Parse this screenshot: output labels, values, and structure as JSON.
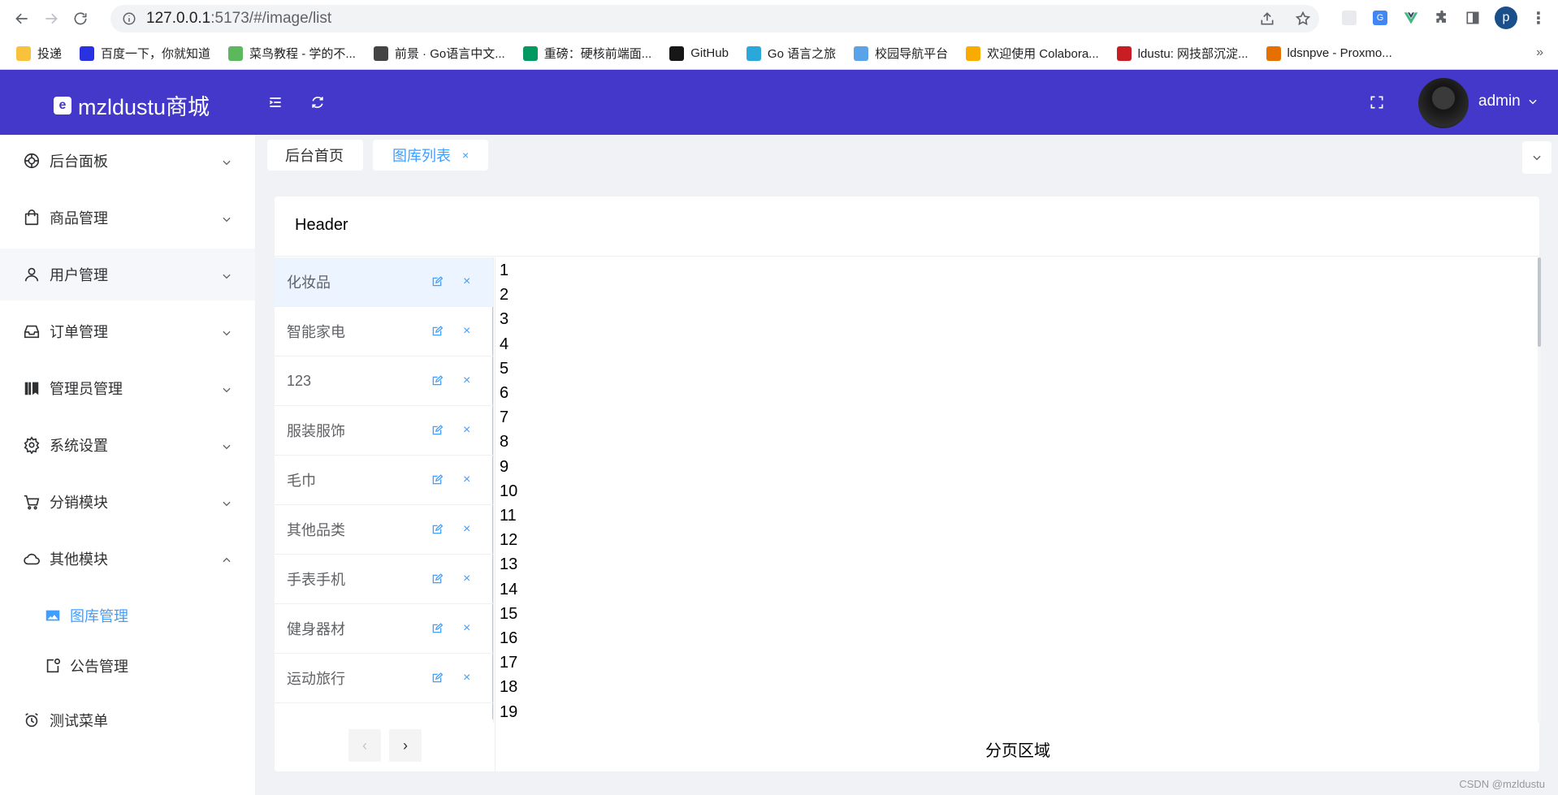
{
  "browser": {
    "url_host": "127.0.0.1",
    "url_rest": ":5173/#/image/list",
    "profile_initial": "p",
    "bookmarks": [
      {
        "label": "投递",
        "color": "#f9c23c"
      },
      {
        "label": "百度一下，你就知道",
        "color": "#2932e1"
      },
      {
        "label": "菜鸟教程 - 学的不...",
        "color": "#5cb85c"
      },
      {
        "label": "前景 · Go语言中文...",
        "color": "#444444"
      },
      {
        "label": "重磅：硬核前端面...",
        "color": "#009a61"
      },
      {
        "label": "GitHub",
        "color": "#181717"
      },
      {
        "label": "Go 语言之旅",
        "color": "#2aa8d9"
      },
      {
        "label": "校园导航平台",
        "color": "#5aa3e8"
      },
      {
        "label": "欢迎使用 Colabora...",
        "color": "#f9ab00"
      },
      {
        "label": "ldustu: 网技部沉淀...",
        "color": "#c71d23"
      },
      {
        "label": "ldsnpve - Proxmo...",
        "color": "#e57000"
      }
    ],
    "more": "»"
  },
  "header": {
    "logo_text": "mzldustu商城",
    "user_name": "admin"
  },
  "sidebar": {
    "items": [
      {
        "label": "后台面板",
        "icon": "dashboard-icon"
      },
      {
        "label": "商品管理",
        "icon": "shopping-bag-icon"
      },
      {
        "label": "用户管理",
        "icon": "user-icon"
      },
      {
        "label": "订单管理",
        "icon": "inbox-icon"
      },
      {
        "label": "管理员管理",
        "icon": "collection-icon"
      },
      {
        "label": "系统设置",
        "icon": "gear-icon"
      },
      {
        "label": "分销模块",
        "icon": "cart-icon"
      },
      {
        "label": "其他模块",
        "icon": "cloud-icon"
      }
    ],
    "sub_items": [
      {
        "label": "图库管理",
        "icon": "picture-icon",
        "active": true
      },
      {
        "label": "公告管理",
        "icon": "notification-icon",
        "active": false
      }
    ],
    "last_item": {
      "label": "测试菜单",
      "icon": "alarm-clock-icon"
    }
  },
  "tabs": [
    {
      "label": "后台首页",
      "active": false
    },
    {
      "label": "图库列表",
      "active": true,
      "close": "×"
    }
  ],
  "card": {
    "header_title": "Header",
    "categories": [
      "化妆品",
      "智能家电",
      "123",
      "服装服饰",
      "毛巾",
      "其他品类",
      "手表手机",
      "健身器材",
      "运动旅行"
    ],
    "image_rows": [
      "1",
      "2",
      "3",
      "4",
      "5",
      "6",
      "7",
      "8",
      "9",
      "10",
      "11",
      "12",
      "13",
      "14",
      "15",
      "16",
      "17",
      "18",
      "19"
    ],
    "pagination_label": "分页区域",
    "prev": "‹",
    "next": "›"
  },
  "watermark": "CSDN @mzldustu",
  "colors": {
    "header_bg": "#4338ca",
    "accent": "#409eff"
  }
}
